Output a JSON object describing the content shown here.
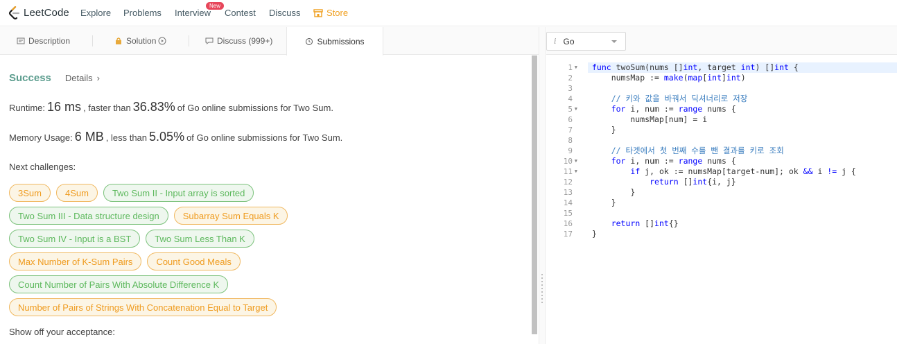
{
  "nav": {
    "logo_text": "LeetCode",
    "items": [
      "Explore",
      "Problems",
      "Interview",
      "Contest",
      "Discuss",
      "Store"
    ],
    "new_badge": "New"
  },
  "tabs": {
    "description": "Description",
    "solution": "Solution",
    "discuss": "Discuss (999+)",
    "submissions": "Submissions"
  },
  "result": {
    "status": "Success",
    "details": "Details",
    "details_chevron": "›",
    "runtime_label": "Runtime:",
    "runtime_value": "16 ms",
    "runtime_mid": ", faster than",
    "runtime_pct": "36.83%",
    "runtime_tail": "of Go online submissions for Two Sum.",
    "memory_label": "Memory Usage:",
    "memory_value": "6 MB",
    "memory_mid": ", less than",
    "memory_pct": "5.05%",
    "memory_tail": "of Go online submissions for Two Sum.",
    "next_label": "Next challenges:",
    "show_off": "Show off your acceptance:"
  },
  "challenges": [
    [
      {
        "label": "3Sum",
        "difficulty": "medium"
      },
      {
        "label": "4Sum",
        "difficulty": "medium"
      },
      {
        "label": "Two Sum II - Input array is sorted",
        "difficulty": "easy"
      }
    ],
    [
      {
        "label": "Two Sum III - Data structure design",
        "difficulty": "easy"
      },
      {
        "label": "Subarray Sum Equals K",
        "difficulty": "medium"
      }
    ],
    [
      {
        "label": "Two Sum IV - Input is a BST",
        "difficulty": "easy"
      },
      {
        "label": "Two Sum Less Than K",
        "difficulty": "easy"
      }
    ],
    [
      {
        "label": "Max Number of K-Sum Pairs",
        "difficulty": "medium"
      },
      {
        "label": "Count Good Meals",
        "difficulty": "medium"
      }
    ],
    [
      {
        "label": "Count Number of Pairs With Absolute Difference K",
        "difficulty": "easy"
      }
    ],
    [
      {
        "label": "Number of Pairs of Strings With Concatenation Equal to Target",
        "difficulty": "medium"
      }
    ]
  ],
  "editor": {
    "language": "Go",
    "lang_icon": "i",
    "lines": [
      "func twoSum(nums []int, target int) []int {",
      "    numsMap := make(map[int]int)",
      "",
      "    // 키와 값을 바꿔서 딕셔너리로 저장",
      "    for i, num := range nums {",
      "        numsMap[num] = i",
      "    }",
      "",
      "    // 타겟에서 첫 번째 수를 뺀 결과를 키로 조회",
      "    for i, num := range nums {",
      "        if j, ok := numsMap[target-num]; ok && i != j {",
      "            return []int{i, j}",
      "        }",
      "    }",
      "",
      "    return []int{}",
      "}"
    ],
    "fold_lines": [
      1,
      5,
      10,
      11
    ]
  },
  "colors": {
    "success": "#5c9d8e",
    "medium_text": "#ef9b1e",
    "easy_text": "#5cb85c",
    "store": "#f0a020",
    "badge": "#e7465a"
  }
}
